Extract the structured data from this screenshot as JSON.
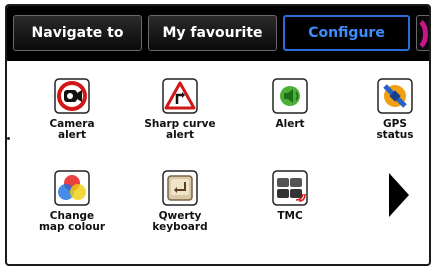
{
  "tabs": [
    {
      "label": "Navigate to",
      "active": false
    },
    {
      "label": "My favourite",
      "active": false
    },
    {
      "label": "Configure",
      "active": true
    }
  ],
  "items": [
    {
      "label": "Camera\nalert",
      "icon": "camera-alert-icon"
    },
    {
      "label": "Sharp curve\nalert",
      "icon": "sharp-curve-icon"
    },
    {
      "label": "Alert",
      "icon": "alert-speaker-icon"
    },
    {
      "label": "GPS\nstatus",
      "icon": "gps-satellite-icon"
    },
    {
      "label": "Change\nmap colour",
      "icon": "color-circles-icon"
    },
    {
      "label": "Qwerty\nkeyboard",
      "icon": "keyboard-key-icon"
    },
    {
      "label": "TMC",
      "icon": "traffic-icon"
    }
  ],
  "colors": {
    "tabbar_bg": "#000000",
    "active_tab_border": "#2a6bd6",
    "active_tab_text": "#3d8dff"
  }
}
